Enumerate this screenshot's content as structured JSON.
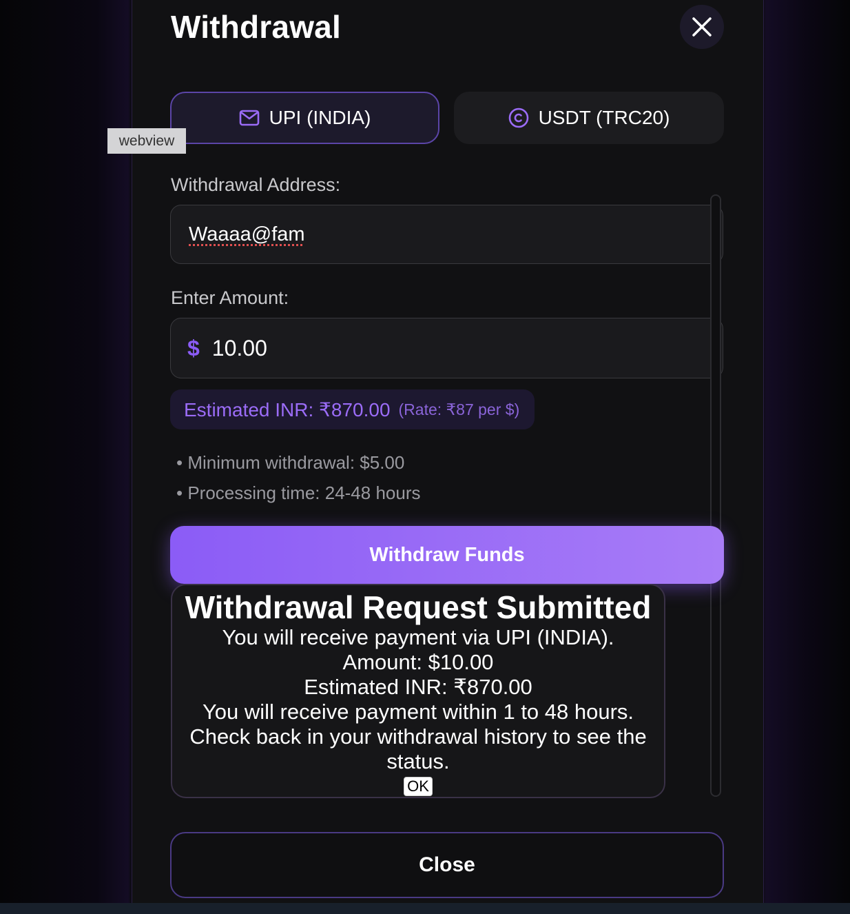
{
  "modal": {
    "title": "Withdrawal",
    "close_icon": "close-x-icon"
  },
  "tabs": [
    {
      "label": "UPI (INDIA)",
      "icon": "mail-icon",
      "selected": true
    },
    {
      "label": "USDT (TRC20)",
      "icon": "coin-icon",
      "selected": false
    }
  ],
  "overlay": {
    "webview_label": "webview"
  },
  "address": {
    "label": "Withdrawal Address:",
    "value": "Waaaa@fam"
  },
  "amount": {
    "label": "Enter Amount:",
    "currency_symbol": "$",
    "value": "10.00"
  },
  "estimate": {
    "main": "Estimated INR: ₹870.00",
    "rate": "(Rate: ₹87 per $)"
  },
  "notes": [
    "Minimum withdrawal: $5.00",
    "Processing time: 24-48 hours"
  ],
  "withdraw_button": "Withdraw Funds",
  "dialog": {
    "title": "Withdrawal Request Submitted",
    "lines": [
      "You will receive payment via UPI (INDIA).",
      "Amount: $10.00",
      "Estimated INR: ₹870.00",
      "You will receive payment within 1 to 48 hours.",
      "Check back in your withdrawal history to see the status."
    ],
    "ok_label": "OK"
  },
  "close_button": "Close",
  "colors": {
    "accent": "#8b5cf6",
    "panel_bg": "#111113",
    "input_bg": "#1a1a1d"
  }
}
